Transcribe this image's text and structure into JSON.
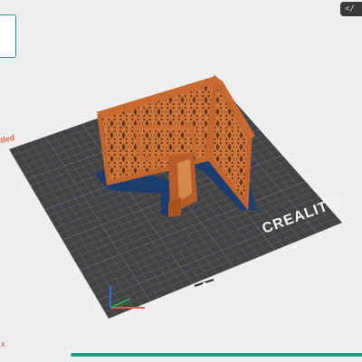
{
  "plate": {
    "label": "itled",
    "brand_text": "CREALITY"
  },
  "toolbar": {
    "top_right_button": "</"
  },
  "close_icon_glyph": "x",
  "progress": {
    "fraction": 1.0
  },
  "colors": {
    "accent": "#1a9f8c",
    "model": "#c1652f",
    "plate": "#414345",
    "model_outline": "#1c3d6e"
  }
}
